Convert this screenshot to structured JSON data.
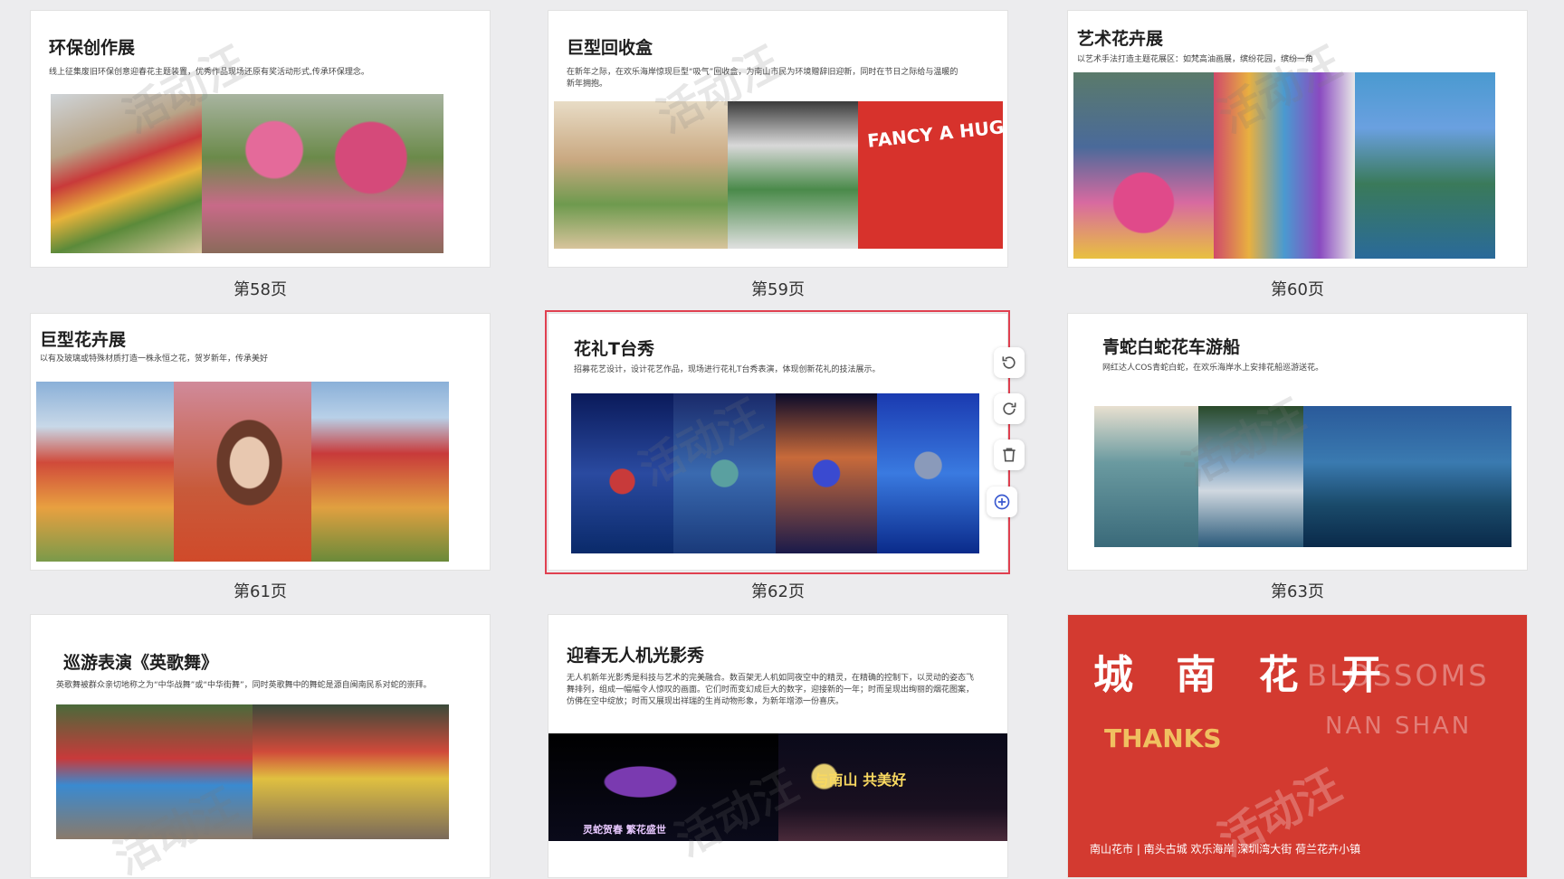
{
  "slides": [
    {
      "title": "环保创作展",
      "desc": "线上征集废旧环保创意迎春花主题装置，优秀作品现场还原有奖活动形式,传承环保理念。",
      "page": "第58页"
    },
    {
      "title": "巨型回收盒",
      "desc": "在新年之际，在欢乐海岸惊现巨型“吸气”回收盒，为南山市民为环境赠辞旧迎新，同时在节日之际给与温暖的新年拥抱。",
      "page": "第59页",
      "photo_text": "FANCY A HUG"
    },
    {
      "title": "艺术花卉展",
      "desc": "以艺术手法打造主题花展区：如梵高油画展，缤纷花园，缤纷一角",
      "page": "第60页"
    },
    {
      "title": "巨型花卉展",
      "desc": "以有及玻璃或特殊材质打造一株永恒之花，贺岁新年，传承美好",
      "page": "第61页"
    },
    {
      "title": "花礼T台秀",
      "desc": "招募花艺设计，设计花艺作品，现场进行花礼T台秀表演，体现创新花礼的技法展示。",
      "page": "第62页"
    },
    {
      "title": "青蛇白蛇花车游船",
      "desc": "网红达人COS青蛇白蛇，在欢乐海岸水上安排花船巡游送花。",
      "page": "第63页"
    },
    {
      "title": "巡游表演《英歌舞》",
      "desc": "英歌舞被群众亲切地称之为“中华战舞”或“中华街舞”，同时英歌舞中的舞蛇是源自闽南民系对蛇的崇拜。"
    },
    {
      "title": "迎春无人机光影秀",
      "desc": "无人机新年光影秀是科技与艺术的完美融合。数百架无人机如同夜空中的精灵，在精确的控制下，以灵动的姿态飞舞排列，组成一幅幅令人惊叹的画面。它们时而变幻成巨大的数字，迎接新的一年；时而呈现出绚丽的烟花图案，仿佛在空中绽放；时而又展现出祥瑞的生肖动物形象，为新年增添一份喜庆。",
      "photo_text": "与南山 共美好",
      "photo_text2": "灵蛇贺春 繁花盛世"
    },
    {
      "title": "城 南 花 开",
      "en1": "BLOSSOMS",
      "en2": "NAN SHAN",
      "thanks": "THANKS",
      "footer": "南山花市 | 南头古城  欢乐海岸  深圳湾大街  荷兰花卉小镇"
    }
  ],
  "toolbar": {
    "rotate_left": "rotate-left-icon",
    "rotate_right": "rotate-right-icon",
    "delete": "trash-icon",
    "add": "plus-circle-icon"
  },
  "watermark": "活动汪",
  "colors": {
    "selection": "#e04050",
    "red_slide": "#d33a30",
    "thanks": "#f0c060"
  }
}
